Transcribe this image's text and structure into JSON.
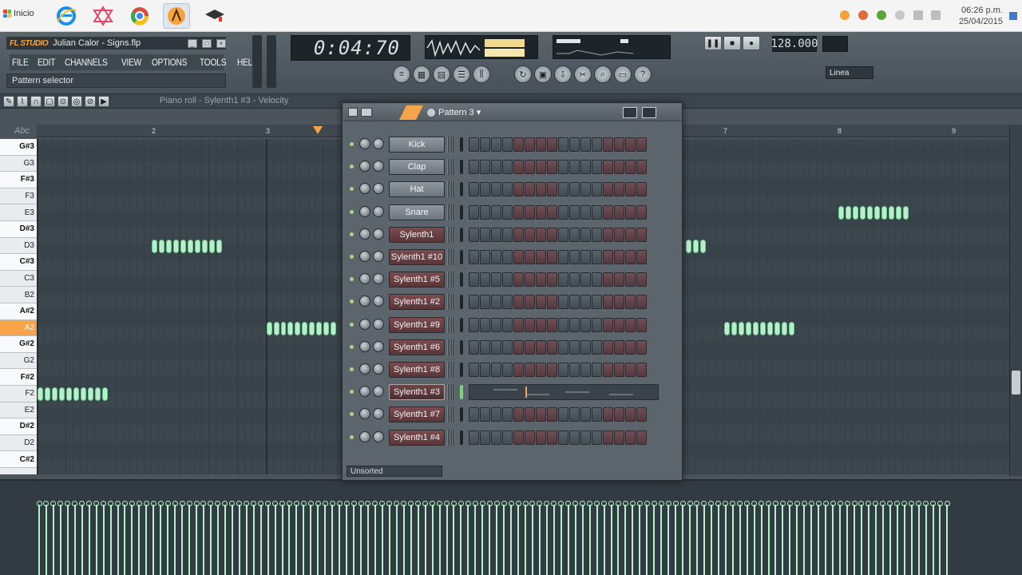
{
  "taskbar": {
    "start_label": "Inicio",
    "apps": [
      "internet-explorer-icon",
      "generic-app-icon",
      "chrome-icon",
      "fl-studio-icon",
      "graduation-app-icon"
    ],
    "clock_time": "06:26 p.m.",
    "clock_date": "25/04/2015"
  },
  "app": {
    "logo": "FL STUDIO",
    "title": "Julian Calor - Signs.flp",
    "menu": [
      "FILE",
      "EDIT",
      "CHANNELS",
      "VIEW",
      "OPTIONS",
      "TOOLS",
      "HELP"
    ],
    "hint": "Pattern selector",
    "time_display": "0:04:70",
    "tempo": "128.000",
    "snap": "Linea",
    "colors": {
      "accent": "#f6a34a",
      "note": "#b5f0c9",
      "bg": "#3a4248"
    }
  },
  "pianoroll": {
    "title": "Piano roll - Sylenth1 #3 - Velocity",
    "keys": [
      "G#3",
      "G3",
      "F#3",
      "F3",
      "E3",
      "D#3",
      "D3",
      "C#3",
      "C3",
      "B2",
      "A#2",
      "A2",
      "G#2",
      "G2",
      "F#2",
      "F2",
      "E2",
      "D#2",
      "D2",
      "C#2"
    ],
    "bar_numbers": [
      "2",
      "3",
      "7",
      "8",
      "9"
    ]
  },
  "sequencer": {
    "title": "Pattern 3",
    "filter": "Unsorted",
    "channels": [
      {
        "name": "Kick",
        "kind": "drum"
      },
      {
        "name": "Clap",
        "kind": "drum"
      },
      {
        "name": "Hat",
        "kind": "drum"
      },
      {
        "name": "Snare",
        "kind": "drum"
      },
      {
        "name": "Sylenth1",
        "kind": "synth"
      },
      {
        "name": "Sylenth1 #10",
        "kind": "synth"
      },
      {
        "name": "Sylenth1 #5",
        "kind": "synth"
      },
      {
        "name": "Sylenth1 #2",
        "kind": "synth"
      },
      {
        "name": "Sylenth1 #9",
        "kind": "synth"
      },
      {
        "name": "Sylenth1 #6",
        "kind": "synth"
      },
      {
        "name": "Sylenth1 #8",
        "kind": "synth"
      },
      {
        "name": "Sylenth1 #3",
        "kind": "selected"
      },
      {
        "name": "Sylenth1 #7",
        "kind": "synth"
      },
      {
        "name": "Sylenth1 #4",
        "kind": "synth"
      }
    ]
  }
}
